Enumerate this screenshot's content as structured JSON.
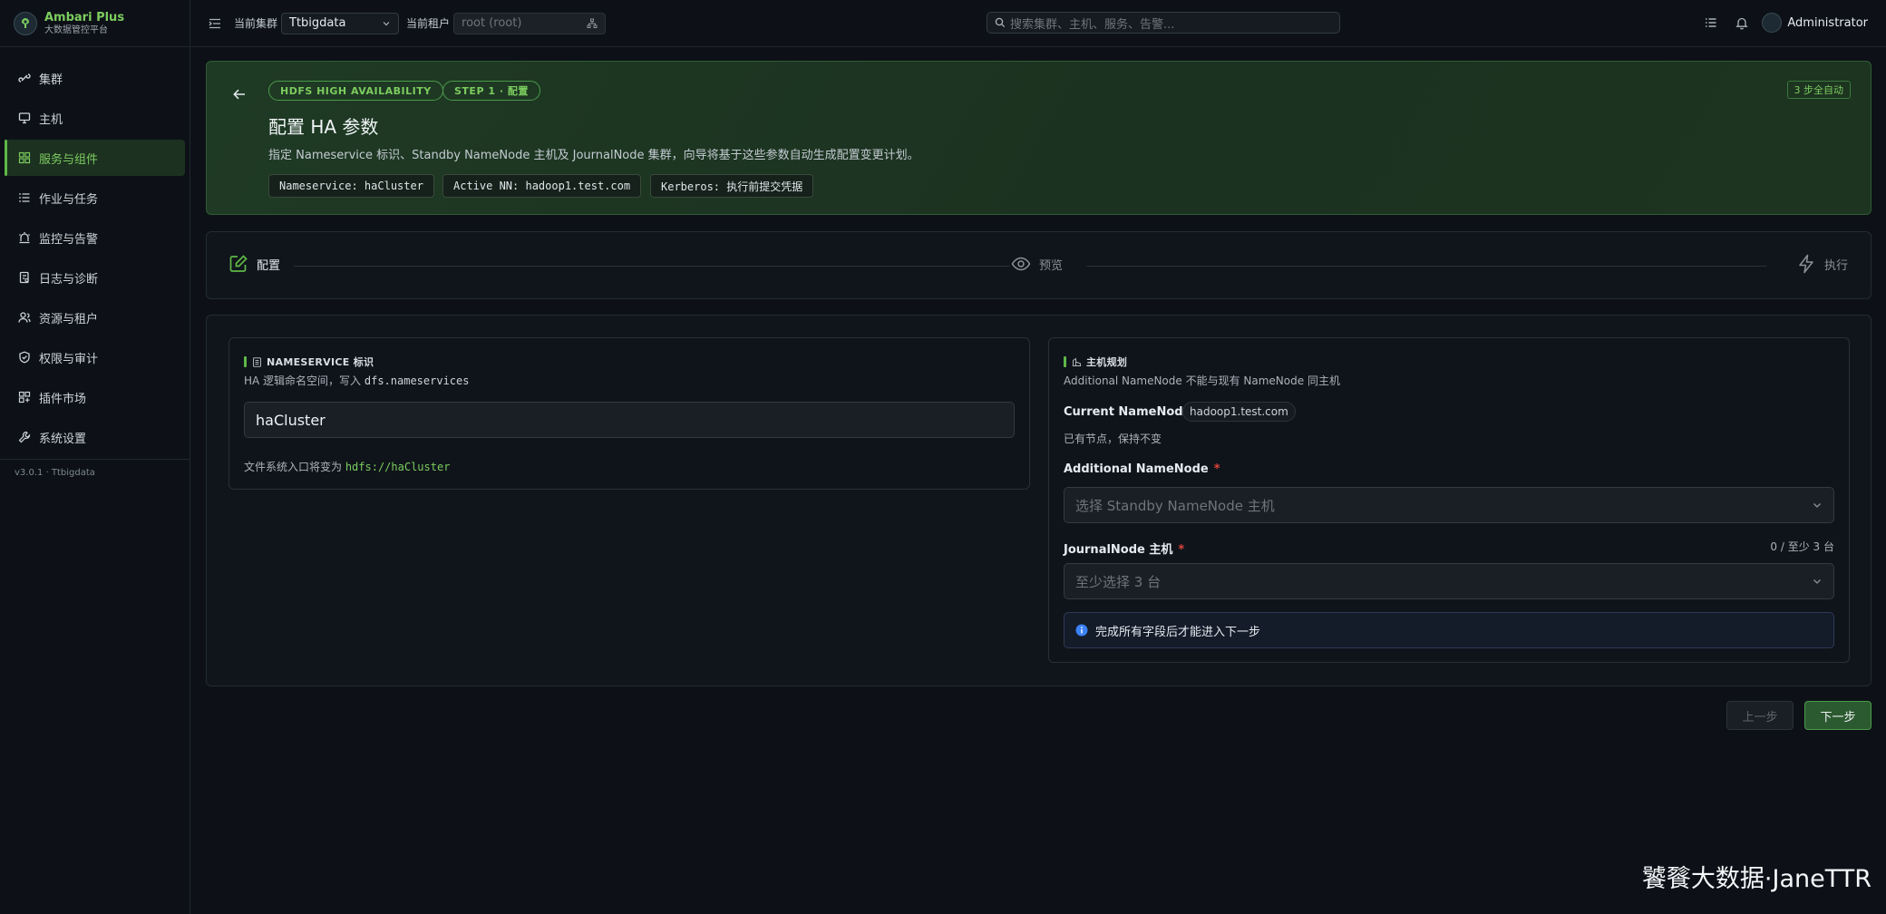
{
  "brand": {
    "name": "Ambari Plus",
    "subtitle": "大数据管控平台"
  },
  "sidebar": {
    "items": [
      {
        "label": "集群",
        "icon": "cluster-icon"
      },
      {
        "label": "主机",
        "icon": "monitor-icon"
      },
      {
        "label": "服务与组件",
        "icon": "grid-icon",
        "active": true
      },
      {
        "label": "作业与任务",
        "icon": "list-icon"
      },
      {
        "label": "监控与告警",
        "icon": "alarm-icon"
      },
      {
        "label": "日志与诊断",
        "icon": "log-icon"
      },
      {
        "label": "资源与租户",
        "icon": "users-icon"
      },
      {
        "label": "权限与审计",
        "icon": "shield-icon"
      },
      {
        "label": "插件市场",
        "icon": "plugin-icon"
      },
      {
        "label": "系统设置",
        "icon": "wrench-icon"
      }
    ],
    "version": "v3.0.1 · Ttbigdata"
  },
  "topbar": {
    "cluster_label": "当前集群",
    "cluster_value": "Ttbigdata",
    "tenant_label": "当前租户",
    "tenant_placeholder": "root (root)",
    "search_placeholder": "搜索集群、主机、服务、告警...",
    "user": "Administrator"
  },
  "hero": {
    "badge1": "HDFS HIGH AVAILABILITY",
    "badge2": "STEP 1 · 配置",
    "title": "配置 HA 参数",
    "description": "指定 Nameservice 标识、Standby NameNode 主机及 JournalNode 集群，向导将基于这些参数自动生成配置变更计划。",
    "chips": [
      "Nameservice: haCluster",
      "Active NN: hadoop1.test.com",
      "Kerberos: 执行前提交凭据"
    ],
    "auto_badge": "3 步全自动"
  },
  "steps": [
    {
      "label": "配置",
      "state": "active"
    },
    {
      "label": "预览",
      "state": "pending"
    },
    {
      "label": "执行",
      "state": "pending"
    }
  ],
  "nameservice": {
    "heading": "NAMESERVICE 标识",
    "subtitle_prefix": "HA 逻辑命名空间，写入 ",
    "subtitle_code": "dfs.nameservices",
    "value": "haCluster",
    "hint_prefix": "文件系统入口将变为 ",
    "hint_code": "hdfs://haCluster"
  },
  "hosts": {
    "heading": "主机规划",
    "subtitle": "Additional NameNode 不能与现有 NameNode 同主机",
    "current_label": "Current NameNode",
    "current_value": "hadoop1.test.com",
    "current_note": "已有节点，保持不变",
    "additional_label": "Additional NameNode",
    "additional_placeholder": "选择 Standby NameNode 主机",
    "journal_label": "JournalNode 主机",
    "journal_count": "0 / 至少 3 台",
    "journal_placeholder": "至少选择 3 台",
    "required_mark": "*",
    "info": "完成所有字段后才能进入下一步"
  },
  "buttons": {
    "prev": "上一步",
    "next": "下一步"
  },
  "watermark": "饕餮大数据·JaneTTR",
  "colors": {
    "accent": "#7ccc5f",
    "background": "#0d1117",
    "hero": "#1b3220",
    "required": "#e0433b",
    "info": "#3b82f6"
  }
}
